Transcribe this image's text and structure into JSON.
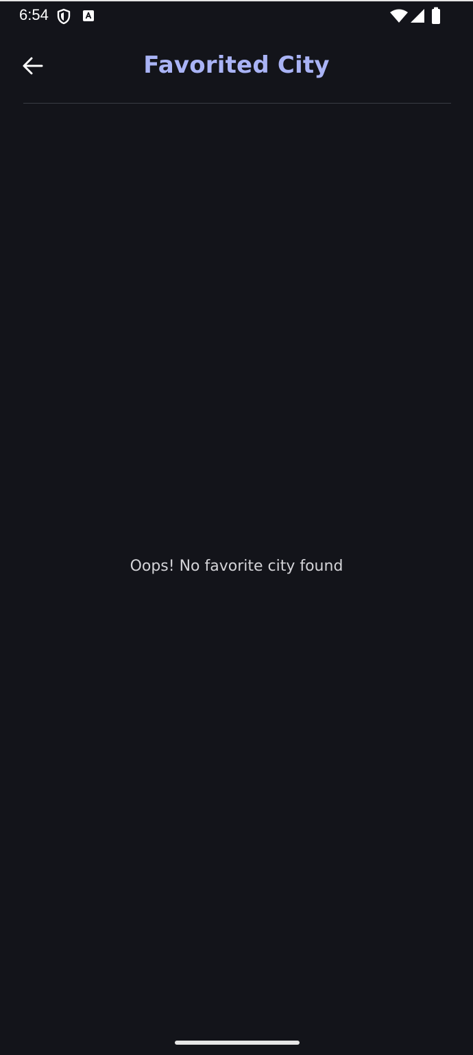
{
  "status_bar": {
    "time": "6:54",
    "icons": [
      "shield-icon",
      "keyboard-a-icon",
      "wifi-icon",
      "signal-icon",
      "battery-icon"
    ]
  },
  "app_bar": {
    "back_icon": "arrow-left-icon",
    "title": "Favorited City"
  },
  "main": {
    "empty_message": "Oops! No favorite city found"
  },
  "colors": {
    "background": "#13141a",
    "title": "#a9b3f5",
    "message": "#d4d4d8",
    "divider": "#3a3c44"
  }
}
